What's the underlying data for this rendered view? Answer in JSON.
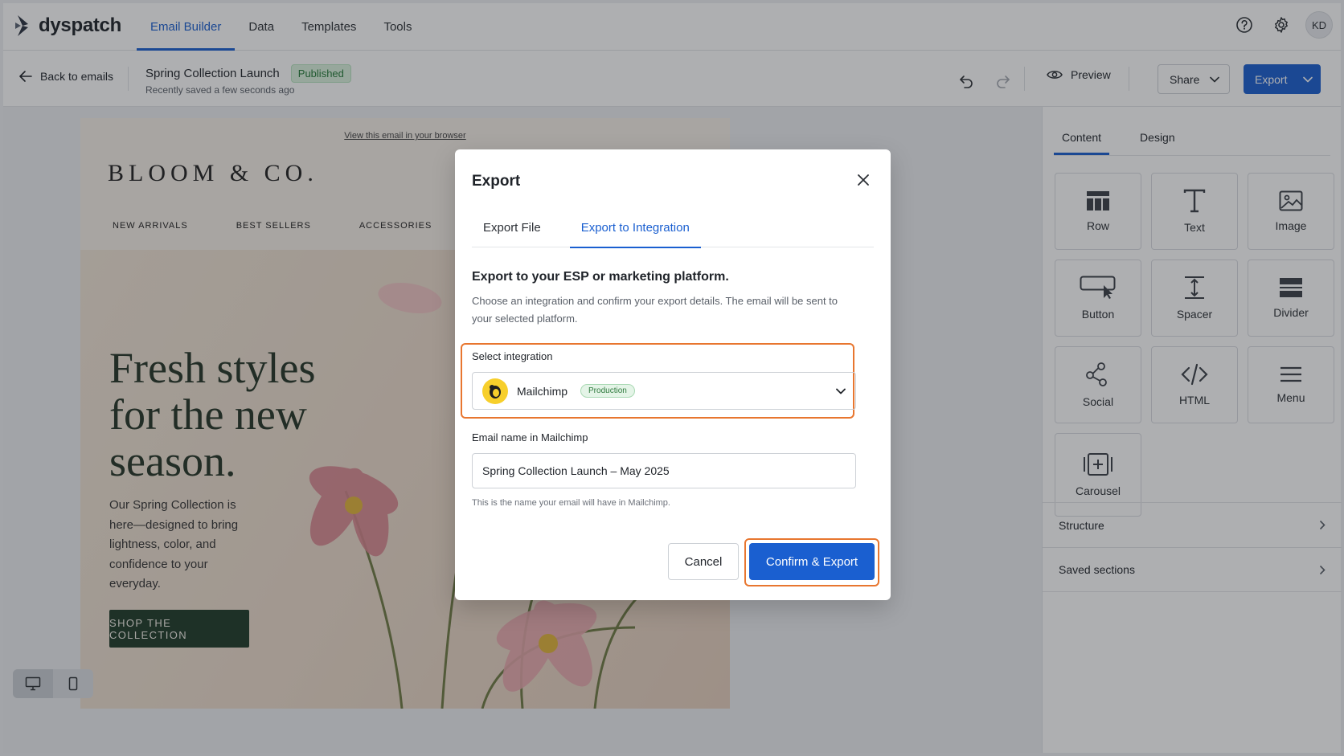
{
  "app": {
    "name": "dyspatch",
    "user_initials": "KD"
  },
  "nav": {
    "tabs": [
      "Email Builder",
      "Data",
      "Templates",
      "Tools"
    ],
    "active": "Email Builder"
  },
  "subbar": {
    "back_label": "Back to emails",
    "doc_title": "Spring Collection Launch",
    "status": "Published",
    "saved_text": "Recently saved a few seconds ago",
    "preview_label": "Preview",
    "share_label": "Share",
    "export_label": "Export"
  },
  "email": {
    "view_link": "View this email in your browser",
    "brand": "BLOOM & CO.",
    "nav": [
      "NEW ARRIVALS",
      "BEST SELLERS",
      "ACCESSORIES"
    ],
    "headline": "Fresh styles for the new season.",
    "body": "Our Spring Collection is here—designed to bring lightness, color, and confidence to your everyday.",
    "cta": "SHOP THE COLLECTION"
  },
  "panel": {
    "tabs": [
      "Content",
      "Design"
    ],
    "active_tab": "Content",
    "blocks": [
      {
        "label": "Row",
        "icon": "row-icon"
      },
      {
        "label": "Text",
        "icon": "text-icon"
      },
      {
        "label": "Image",
        "icon": "image-icon"
      },
      {
        "label": "Button",
        "icon": "button-icon"
      },
      {
        "label": "Spacer",
        "icon": "spacer-icon"
      },
      {
        "label": "Divider",
        "icon": "divider-icon"
      },
      {
        "label": "Social",
        "icon": "social-icon"
      },
      {
        "label": "HTML",
        "icon": "html-icon"
      },
      {
        "label": "Menu",
        "icon": "menu-icon"
      },
      {
        "label": "Carousel",
        "icon": "carousel-icon"
      }
    ],
    "sections": [
      "Structure",
      "Saved sections"
    ]
  },
  "modal": {
    "title": "Export",
    "tabs": [
      "Export File",
      "Export to Integration"
    ],
    "active_tab": "Export to Integration",
    "heading": "Export to your ESP or marketing platform.",
    "description": "Choose an integration and confirm your export details. The email will be sent to your selected platform.",
    "select_label": "Select integration",
    "integration": "Mailchimp",
    "integration_env": "Production",
    "name_label": "Email name in Mailchimp",
    "name_value": "Spring Collection Launch – May 2025",
    "hint": "This is the name your email will have in Mailchimp.",
    "cancel": "Cancel",
    "confirm": "Confirm & Export"
  },
  "colors": {
    "accent": "#1a5fd0",
    "highlight": "#e8762f",
    "cta_green": "#1f3a28"
  }
}
